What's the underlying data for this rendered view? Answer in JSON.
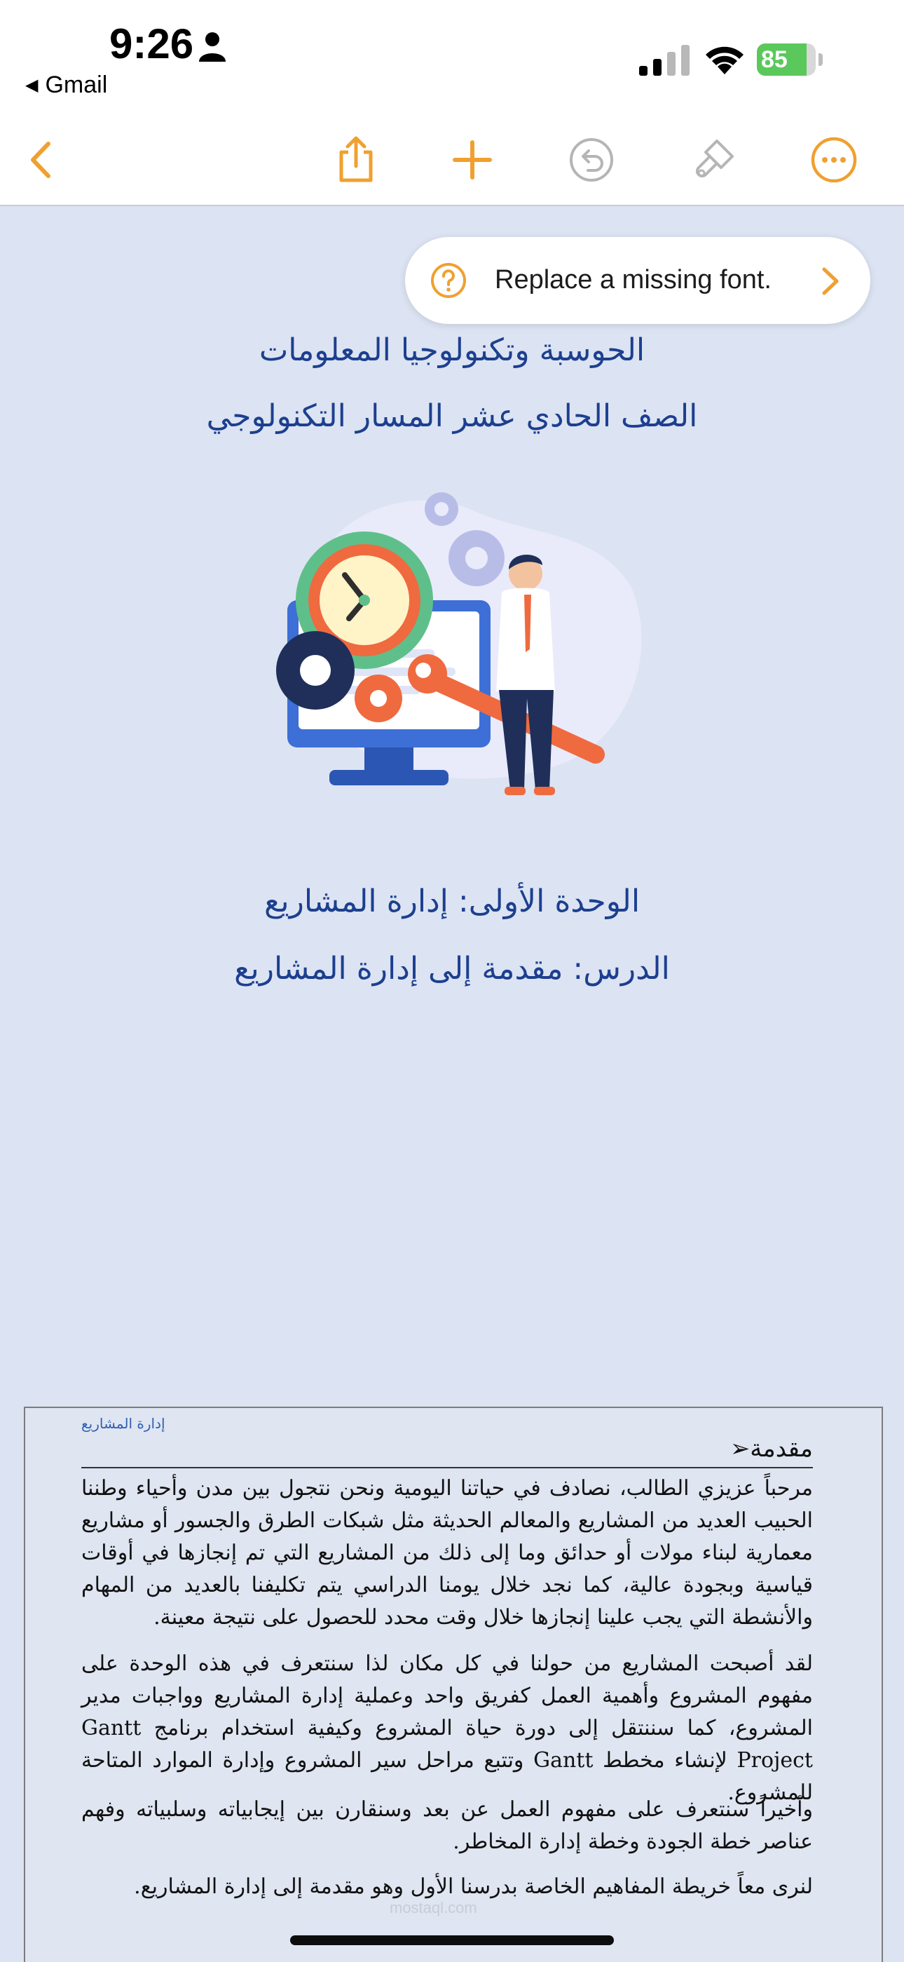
{
  "status_bar": {
    "time": "9:26",
    "back_app": "Gmail",
    "battery_percent": "85",
    "battery_level": 0.85
  },
  "toolbar": {
    "icons": [
      "back-chevron-icon",
      "share-icon",
      "add-icon",
      "undo-icon",
      "format-brush-icon",
      "more-icon"
    ],
    "accent_color": "#f0a030"
  },
  "toast": {
    "message": "Replace a missing font."
  },
  "cover": {
    "line1": "الحوسبة وتكنولوجيا المعلومات",
    "line2": "الصف الحادي عشر المسار التكنولوجي",
    "unit": "الوحدة الأولى: إدارة المشاريع",
    "lesson": "الدرس: مقدمة إلى إدارة المشاريع"
  },
  "page2": {
    "header_note": "إدارة المشاريع",
    "heading": "مقدمة➢",
    "paragraph1": "مرحباً عزيزي الطالب، نصادف في حياتنا اليومية ونحن نتجول بين مدن وأحياء وطننا الحبيب العديد من المشاريع والمعالم الحديثة مثل شبكات الطرق والجسور أو مشاريع معمارية لبناء مولات أو حدائق وما إلى ذلك من المشاريع التي تم إنجازها في أوقات قياسية وبجودة عالية، كما نجد خلال يومنا الدراسي يتم تكليفنا بالعديد من المهام والأنشطة التي يجب علينا إنجازها خلال وقت محدد للحصول على نتيجة معينة.",
    "paragraph2": "لقد أصبحت المشاريع من حولنا في كل مكان لذا سنتعرف في هذه الوحدة على مفهوم المشروع وأهمية العمل كفريق واحد وعملية إدارة المشاريع وواجبات مدير المشروع، كما سننتقل إلى دورة حياة المشروع وكيفية استخدام برنامج Gantt Project لإنشاء مخطط Gantt وتتبع مراحل سير المشروع وإدارة الموارد المتاحة للمشروع.",
    "paragraph3": "وأخيراً سنتعرف على مفهوم العمل عن بعد وسنقارن بين إيجابياته وسلبياته وفهم عناصر خطة الجودة وخطة إدارة المخاطر.",
    "paragraph4": "لنرى معاً خريطة المفاهيم الخاصة بدرسنا الأول وهو مقدمة إلى إدارة المشاريع.",
    "watermark": "mostaql.com"
  }
}
